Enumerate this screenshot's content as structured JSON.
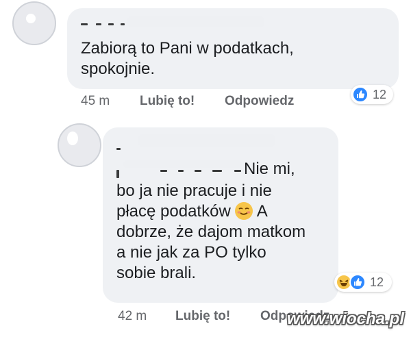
{
  "comments": [
    {
      "text_lines": [
        "Zabiorą to Pani w podatkach,",
        "spokojnie."
      ],
      "time": "45 m",
      "like_label": "Lubię to!",
      "reply_label": "Odpowiedz",
      "reaction_count": "12",
      "reactions": [
        "like-icon"
      ]
    },
    {
      "text_lines": [
        "Nie mi,",
        "bo ja nie pracuje i nie",
        "płacę podatków",
        "A",
        "dobrze, że dajom matkom",
        "a nie jak za PO tylko",
        "sobie brali."
      ],
      "time": "42 m",
      "like_label": "Lubię to!",
      "reply_label": "Odpowiedz",
      "reaction_count": "12",
      "reactions": [
        "haha-icon",
        "like-icon"
      ]
    }
  ],
  "watermark": "www.wiocha.pl",
  "colors": {
    "bubble": "#eff1f4",
    "meta_text": "#65676b",
    "like_blue": "#2d88ff",
    "emoji_yellow": "#f7c54a"
  }
}
